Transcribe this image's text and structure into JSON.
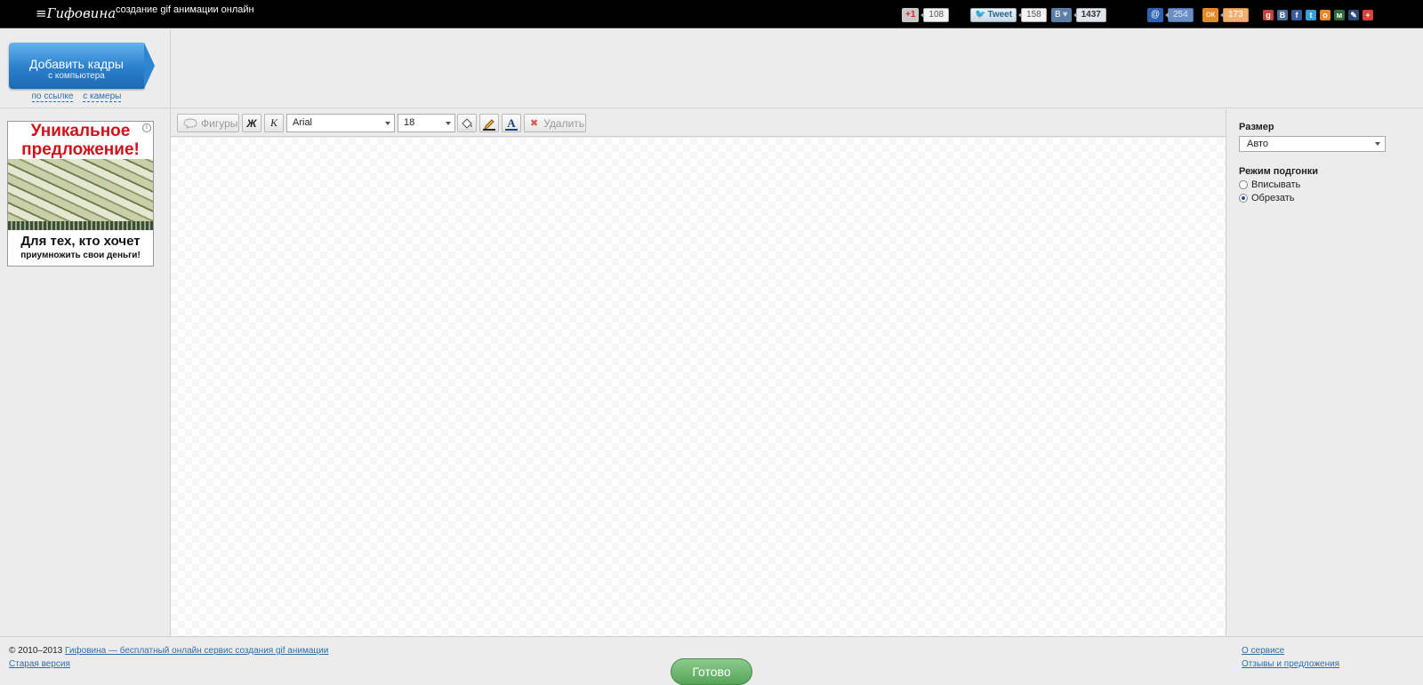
{
  "header": {
    "logo": "Гифовина",
    "tagline": "создание gif анимации онлайн",
    "share": {
      "gplus": {
        "label": "+1",
        "count": "108"
      },
      "twitter": {
        "label": "Tweet",
        "count": "158"
      },
      "vk": {
        "label": "В",
        "count": "1437"
      },
      "mailru": {
        "label": "@",
        "count": "254"
      },
      "odnoklassniki": {
        "label": "ок",
        "count": "173"
      }
    },
    "mini_icons": [
      {
        "name": "gplus-icon",
        "glyph": "g",
        "color": "#c4463b"
      },
      {
        "name": "vk-icon",
        "glyph": "В",
        "color": "#4a6f98"
      },
      {
        "name": "facebook-icon",
        "glyph": "f",
        "color": "#3b5a9a"
      },
      {
        "name": "twitter-icon",
        "glyph": "t",
        "color": "#33a1d8"
      },
      {
        "name": "odnoklassniki-icon",
        "glyph": "о",
        "color": "#e6882b"
      },
      {
        "name": "moimir-icon",
        "glyph": "м",
        "color": "#2e6d3a"
      },
      {
        "name": "livejournal-icon",
        "glyph": "✎",
        "color": "#2c4a74"
      },
      {
        "name": "more-icon",
        "glyph": "+",
        "color": "#d9413a"
      }
    ]
  },
  "left": {
    "add_button": {
      "title": "Добавить кадры",
      "subtitle": "с компьютера"
    },
    "link_by_url": "по ссылке",
    "link_camera": "с камеры",
    "ad": {
      "headline": "Уникальное предложение!",
      "line1": "Для тех, кто хочет",
      "line2": "приумножить свои деньги!"
    }
  },
  "toolbar": {
    "shapes": "Фигуры",
    "bold": "Ж",
    "italic": "К",
    "font": "Arial",
    "size": "18",
    "text_color_glyph": "A",
    "delete": "Удалить",
    "delete_glyph": "✖"
  },
  "right": {
    "size_label": "Размер",
    "size_value": "Авто",
    "fit_label": "Режим подгонки",
    "fit_options": [
      {
        "label": "Вписывать",
        "selected": false
      },
      {
        "label": "Обрезать",
        "selected": true
      }
    ]
  },
  "footer": {
    "copyright": "© 2010–2013",
    "copyright_link": "Гифовина — бесплатный онлайн сервис создания gif анимации",
    "old_version": "Старая версия",
    "done": "Готово",
    "about": "О сервисе",
    "feedback": "Отзывы и предложения"
  },
  "colors": {
    "accent_blue": "#2a7fcc",
    "done_green": "#58a45a",
    "link": "#2a6fb0"
  }
}
